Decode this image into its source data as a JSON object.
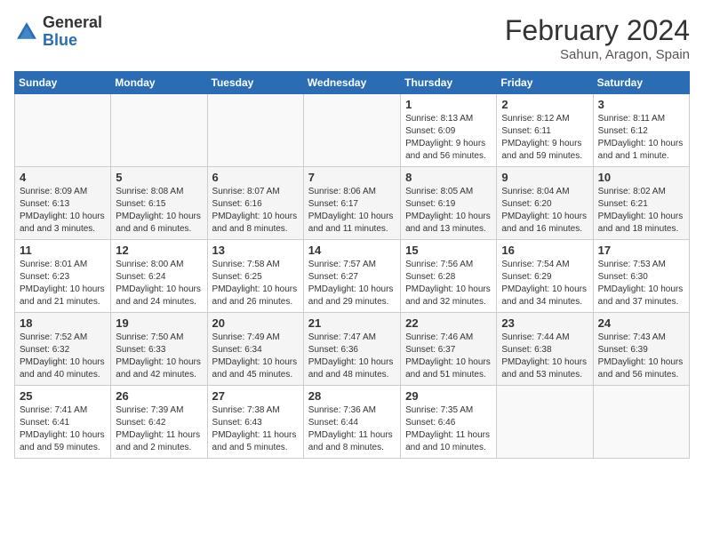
{
  "header": {
    "logo_general": "General",
    "logo_blue": "Blue",
    "month_year": "February 2024",
    "location": "Sahun, Aragon, Spain"
  },
  "days_of_week": [
    "Sunday",
    "Monday",
    "Tuesday",
    "Wednesday",
    "Thursday",
    "Friday",
    "Saturday"
  ],
  "weeks": [
    {
      "cells": [
        {
          "day": "",
          "info": ""
        },
        {
          "day": "",
          "info": ""
        },
        {
          "day": "",
          "info": ""
        },
        {
          "day": "",
          "info": ""
        },
        {
          "day": "1",
          "info": "Sunrise: 8:13 AM\nSunset: 6:09 PM\nDaylight: 9 hours and 56 minutes."
        },
        {
          "day": "2",
          "info": "Sunrise: 8:12 AM\nSunset: 6:11 PM\nDaylight: 9 hours and 59 minutes."
        },
        {
          "day": "3",
          "info": "Sunrise: 8:11 AM\nSunset: 6:12 PM\nDaylight: 10 hours and 1 minute."
        }
      ]
    },
    {
      "cells": [
        {
          "day": "4",
          "info": "Sunrise: 8:09 AM\nSunset: 6:13 PM\nDaylight: 10 hours and 3 minutes."
        },
        {
          "day": "5",
          "info": "Sunrise: 8:08 AM\nSunset: 6:15 PM\nDaylight: 10 hours and 6 minutes."
        },
        {
          "day": "6",
          "info": "Sunrise: 8:07 AM\nSunset: 6:16 PM\nDaylight: 10 hours and 8 minutes."
        },
        {
          "day": "7",
          "info": "Sunrise: 8:06 AM\nSunset: 6:17 PM\nDaylight: 10 hours and 11 minutes."
        },
        {
          "day": "8",
          "info": "Sunrise: 8:05 AM\nSunset: 6:19 PM\nDaylight: 10 hours and 13 minutes."
        },
        {
          "day": "9",
          "info": "Sunrise: 8:04 AM\nSunset: 6:20 PM\nDaylight: 10 hours and 16 minutes."
        },
        {
          "day": "10",
          "info": "Sunrise: 8:02 AM\nSunset: 6:21 PM\nDaylight: 10 hours and 18 minutes."
        }
      ]
    },
    {
      "cells": [
        {
          "day": "11",
          "info": "Sunrise: 8:01 AM\nSunset: 6:23 PM\nDaylight: 10 hours and 21 minutes."
        },
        {
          "day": "12",
          "info": "Sunrise: 8:00 AM\nSunset: 6:24 PM\nDaylight: 10 hours and 24 minutes."
        },
        {
          "day": "13",
          "info": "Sunrise: 7:58 AM\nSunset: 6:25 PM\nDaylight: 10 hours and 26 minutes."
        },
        {
          "day": "14",
          "info": "Sunrise: 7:57 AM\nSunset: 6:27 PM\nDaylight: 10 hours and 29 minutes."
        },
        {
          "day": "15",
          "info": "Sunrise: 7:56 AM\nSunset: 6:28 PM\nDaylight: 10 hours and 32 minutes."
        },
        {
          "day": "16",
          "info": "Sunrise: 7:54 AM\nSunset: 6:29 PM\nDaylight: 10 hours and 34 minutes."
        },
        {
          "day": "17",
          "info": "Sunrise: 7:53 AM\nSunset: 6:30 PM\nDaylight: 10 hours and 37 minutes."
        }
      ]
    },
    {
      "cells": [
        {
          "day": "18",
          "info": "Sunrise: 7:52 AM\nSunset: 6:32 PM\nDaylight: 10 hours and 40 minutes."
        },
        {
          "day": "19",
          "info": "Sunrise: 7:50 AM\nSunset: 6:33 PM\nDaylight: 10 hours and 42 minutes."
        },
        {
          "day": "20",
          "info": "Sunrise: 7:49 AM\nSunset: 6:34 PM\nDaylight: 10 hours and 45 minutes."
        },
        {
          "day": "21",
          "info": "Sunrise: 7:47 AM\nSunset: 6:36 PM\nDaylight: 10 hours and 48 minutes."
        },
        {
          "day": "22",
          "info": "Sunrise: 7:46 AM\nSunset: 6:37 PM\nDaylight: 10 hours and 51 minutes."
        },
        {
          "day": "23",
          "info": "Sunrise: 7:44 AM\nSunset: 6:38 PM\nDaylight: 10 hours and 53 minutes."
        },
        {
          "day": "24",
          "info": "Sunrise: 7:43 AM\nSunset: 6:39 PM\nDaylight: 10 hours and 56 minutes."
        }
      ]
    },
    {
      "cells": [
        {
          "day": "25",
          "info": "Sunrise: 7:41 AM\nSunset: 6:41 PM\nDaylight: 10 hours and 59 minutes."
        },
        {
          "day": "26",
          "info": "Sunrise: 7:39 AM\nSunset: 6:42 PM\nDaylight: 11 hours and 2 minutes."
        },
        {
          "day": "27",
          "info": "Sunrise: 7:38 AM\nSunset: 6:43 PM\nDaylight: 11 hours and 5 minutes."
        },
        {
          "day": "28",
          "info": "Sunrise: 7:36 AM\nSunset: 6:44 PM\nDaylight: 11 hours and 8 minutes."
        },
        {
          "day": "29",
          "info": "Sunrise: 7:35 AM\nSunset: 6:46 PM\nDaylight: 11 hours and 10 minutes."
        },
        {
          "day": "",
          "info": ""
        },
        {
          "day": "",
          "info": ""
        }
      ]
    }
  ]
}
